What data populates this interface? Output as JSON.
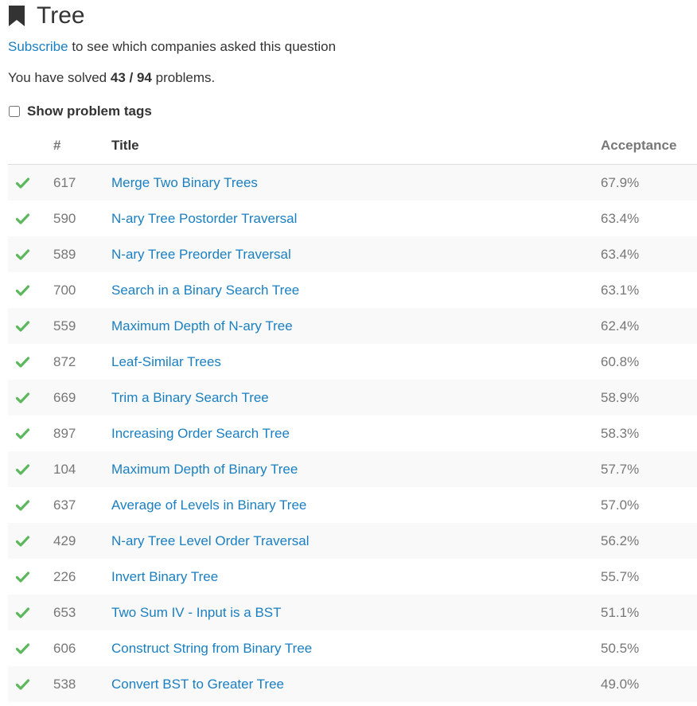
{
  "page": {
    "title": "Tree",
    "subscribe_link": "Subscribe",
    "subscribe_rest": " to see which companies asked this question",
    "solved_prefix": "You have solved ",
    "solved_count": "43",
    "solved_sep": " / ",
    "solved_total": "94",
    "solved_suffix": " problems.",
    "show_tags_label": "Show problem tags",
    "show_tags_checked": false
  },
  "colors": {
    "link": "#1a7fc1",
    "check": "#5cb85c",
    "muted": "#777777"
  },
  "icons": {
    "title": "bookmark-icon",
    "status": "check-icon"
  },
  "table": {
    "headers": {
      "num": "#",
      "title": "Title",
      "acceptance": "Acceptance"
    },
    "rows": [
      {
        "solved": true,
        "num": "617",
        "title": "Merge Two Binary Trees",
        "acceptance": "67.9%"
      },
      {
        "solved": true,
        "num": "590",
        "title": "N-ary Tree Postorder Traversal",
        "acceptance": "63.4%"
      },
      {
        "solved": true,
        "num": "589",
        "title": "N-ary Tree Preorder Traversal",
        "acceptance": "63.4%"
      },
      {
        "solved": true,
        "num": "700",
        "title": "Search in a Binary Search Tree",
        "acceptance": "63.1%"
      },
      {
        "solved": true,
        "num": "559",
        "title": "Maximum Depth of N-ary Tree",
        "acceptance": "62.4%"
      },
      {
        "solved": true,
        "num": "872",
        "title": "Leaf-Similar Trees",
        "acceptance": "60.8%"
      },
      {
        "solved": true,
        "num": "669",
        "title": "Trim a Binary Search Tree",
        "acceptance": "58.9%"
      },
      {
        "solved": true,
        "num": "897",
        "title": "Increasing Order Search Tree",
        "acceptance": "58.3%"
      },
      {
        "solved": true,
        "num": "104",
        "title": "Maximum Depth of Binary Tree",
        "acceptance": "57.7%"
      },
      {
        "solved": true,
        "num": "637",
        "title": "Average of Levels in Binary Tree",
        "acceptance": "57.0%"
      },
      {
        "solved": true,
        "num": "429",
        "title": "N-ary Tree Level Order Traversal",
        "acceptance": "56.2%"
      },
      {
        "solved": true,
        "num": "226",
        "title": "Invert Binary Tree",
        "acceptance": "55.7%"
      },
      {
        "solved": true,
        "num": "653",
        "title": "Two Sum IV - Input is a BST",
        "acceptance": "51.1%"
      },
      {
        "solved": true,
        "num": "606",
        "title": "Construct String from Binary Tree",
        "acceptance": "50.5%"
      },
      {
        "solved": true,
        "num": "538",
        "title": "Convert BST to Greater Tree",
        "acceptance": "49.0%"
      }
    ]
  }
}
